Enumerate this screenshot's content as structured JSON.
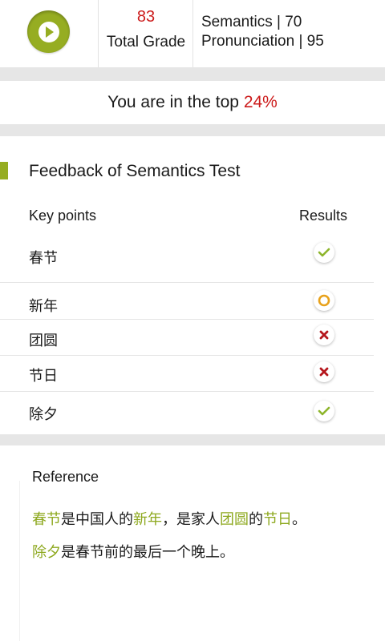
{
  "header": {
    "total_grade_value": "83",
    "total_grade_label": "Total Grade",
    "semantics_line": "Semantics |  70",
    "pronunciation_line": "Pronunciation  |  95"
  },
  "rank": {
    "prefix": "You are in the top ",
    "percent": "24%"
  },
  "feedback": {
    "title": "Feedback of Semantics Test",
    "col_key_points": "Key points",
    "col_results": "Results",
    "rows": [
      {
        "key_point": "春节",
        "result": "correct"
      },
      {
        "key_point": "新年",
        "result": "partial"
      },
      {
        "key_point": "团圆",
        "result": "wrong"
      },
      {
        "key_point": "节日",
        "result": "wrong"
      },
      {
        "key_point": "除夕",
        "result": "correct"
      }
    ]
  },
  "reference": {
    "title": "Reference",
    "line1": [
      {
        "text": "春节",
        "hl": true
      },
      {
        "text": "是中国人的",
        "hl": false
      },
      {
        "text": "新年",
        "hl": true
      },
      {
        "text": "，是家人",
        "hl": false
      },
      {
        "text": "团圆",
        "hl": true
      },
      {
        "text": "的",
        "hl": false
      },
      {
        "text": "节日",
        "hl": true
      },
      {
        "text": "。",
        "hl": false
      }
    ],
    "line2": [
      {
        "text": "除夕",
        "hl": true
      },
      {
        "text": "是春节前的最后一个晚上。",
        "hl": false
      }
    ]
  },
  "colors": {
    "accent_green": "#96ad22",
    "highlight_green": "#8da81e",
    "accent_red": "#cc1b1b",
    "partial_orange": "#e8a11a"
  },
  "icons": {
    "play": "play-icon",
    "correct": "check-icon",
    "partial": "circle-icon",
    "wrong": "cross-icon"
  }
}
